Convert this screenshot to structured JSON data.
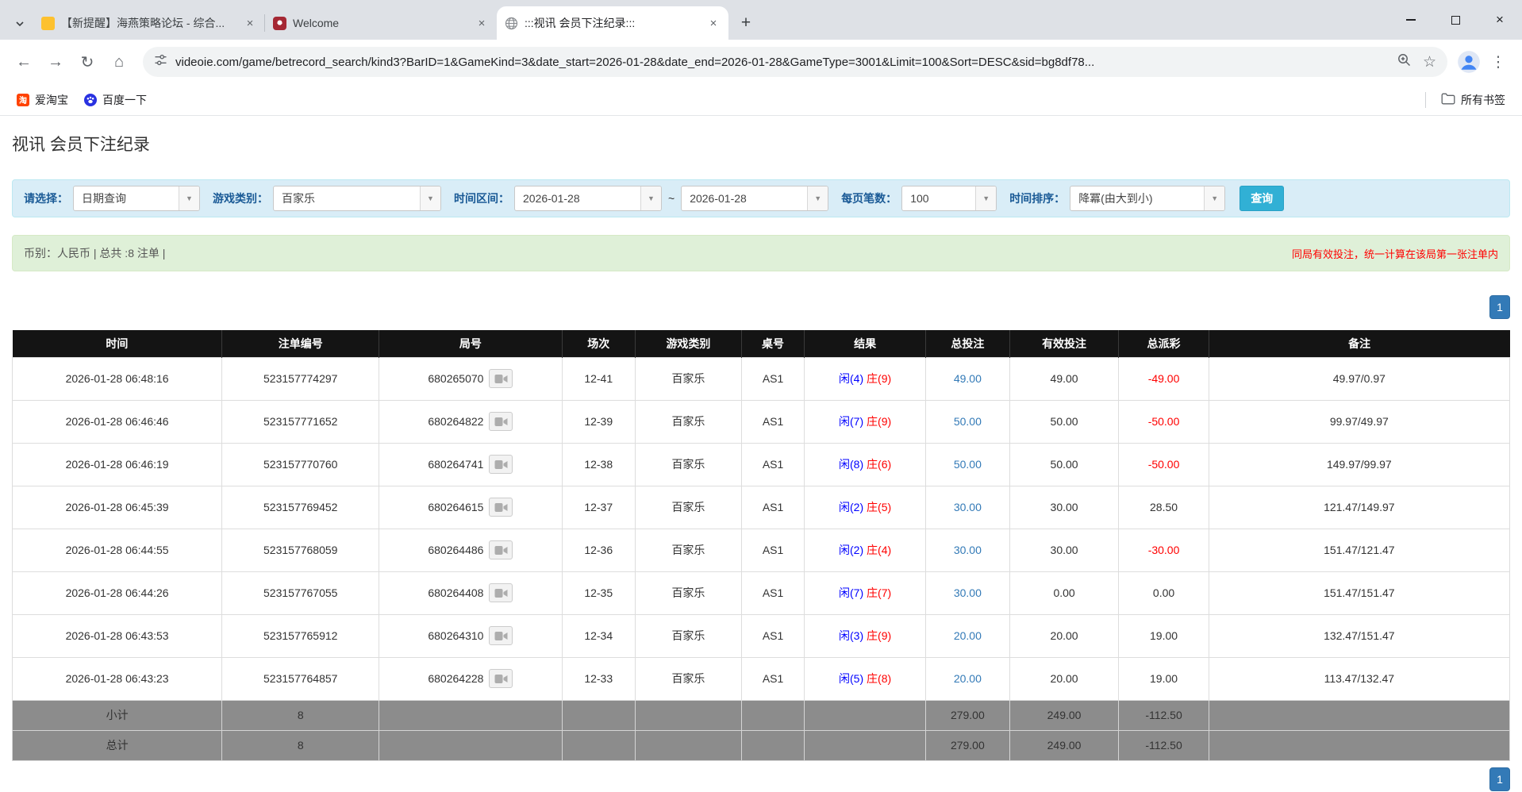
{
  "browser": {
    "tabs": [
      {
        "title": "【新提醒】海燕策略论坛 - 综合...",
        "active": false
      },
      {
        "title": "Welcome",
        "active": false
      },
      {
        "title": ":::视讯 会员下注纪录:::",
        "active": true
      }
    ],
    "url": "videoie.com/game/betrecord_search/kind3?BarID=1&GameKind=3&date_start=2026-01-28&date_end=2026-01-28&GameType=3001&Limit=100&Sort=DESC&sid=bg8df78...",
    "bookmarks": [
      {
        "label": "爱淘宝"
      },
      {
        "label": "百度一下"
      }
    ],
    "all_bookmarks_label": "所有书签"
  },
  "icons": {
    "dropdown": "▼",
    "back": "←",
    "forward": "→",
    "reload": "↻",
    "home": "⌂",
    "star": "☆",
    "menu": "⋮",
    "plus": "+",
    "close": "×",
    "taobao_glyph": "淘"
  },
  "page": {
    "title": "视讯 会员下注纪录",
    "filters": {
      "select_label": "请选择：",
      "select_value": "日期查询",
      "game_label": "游戏类别：",
      "game_value": "百家乐",
      "range_label": "时间区间：",
      "date_start": "2026-01-28",
      "range_separator": "~",
      "date_end": "2026-01-28",
      "per_page_label": "每页笔数：",
      "per_page_value": "100",
      "sort_label": "时间排序：",
      "sort_value": "降冪(由大到小)",
      "search_button": "查询"
    },
    "info_bar": {
      "left": "币别：人民币 | 总共 :8 注单 |",
      "right": "同局有效投注，统一计算在该局第一张注单内"
    },
    "pagination": {
      "page": "1"
    },
    "table": {
      "headers": [
        "时间",
        "注单编号",
        "局号",
        "场次",
        "游戏类别",
        "桌号",
        "结果",
        "总投注",
        "有效投注",
        "总派彩",
        "备注"
      ],
      "rows": [
        {
          "time": "2026-01-28 06:48:16",
          "bet_id": "523157774297",
          "round": "680265070",
          "session": "12-41",
          "game": "百家乐",
          "table_no": "AS1",
          "result_player": "闲(4)",
          "result_banker": "庄(9)",
          "total_bet": "49.00",
          "valid_bet": "49.00",
          "payout": "-49.00",
          "remark": "49.97/0.97"
        },
        {
          "time": "2026-01-28 06:46:46",
          "bet_id": "523157771652",
          "round": "680264822",
          "session": "12-39",
          "game": "百家乐",
          "table_no": "AS1",
          "result_player": "闲(7)",
          "result_banker": "庄(9)",
          "total_bet": "50.00",
          "valid_bet": "50.00",
          "payout": "-50.00",
          "remark": "99.97/49.97"
        },
        {
          "time": "2026-01-28 06:46:19",
          "bet_id": "523157770760",
          "round": "680264741",
          "session": "12-38",
          "game": "百家乐",
          "table_no": "AS1",
          "result_player": "闲(8)",
          "result_banker": "庄(6)",
          "total_bet": "50.00",
          "valid_bet": "50.00",
          "payout": "-50.00",
          "remark": "149.97/99.97"
        },
        {
          "time": "2026-01-28 06:45:39",
          "bet_id": "523157769452",
          "round": "680264615",
          "session": "12-37",
          "game": "百家乐",
          "table_no": "AS1",
          "result_player": "闲(2)",
          "result_banker": "庄(5)",
          "total_bet": "30.00",
          "valid_bet": "30.00",
          "payout": "28.50",
          "remark": "121.47/149.97"
        },
        {
          "time": "2026-01-28 06:44:55",
          "bet_id": "523157768059",
          "round": "680264486",
          "session": "12-36",
          "game": "百家乐",
          "table_no": "AS1",
          "result_player": "闲(2)",
          "result_banker": "庄(4)",
          "total_bet": "30.00",
          "valid_bet": "30.00",
          "payout": "-30.00",
          "remark": "151.47/121.47"
        },
        {
          "time": "2026-01-28 06:44:26",
          "bet_id": "523157767055",
          "round": "680264408",
          "session": "12-35",
          "game": "百家乐",
          "table_no": "AS1",
          "result_player": "闲(7)",
          "result_banker": "庄(7)",
          "total_bet": "30.00",
          "valid_bet": "0.00",
          "payout": "0.00",
          "remark": "151.47/151.47"
        },
        {
          "time": "2026-01-28 06:43:53",
          "bet_id": "523157765912",
          "round": "680264310",
          "session": "12-34",
          "game": "百家乐",
          "table_no": "AS1",
          "result_player": "闲(3)",
          "result_banker": "庄(9)",
          "total_bet": "20.00",
          "valid_bet": "20.00",
          "payout": "19.00",
          "remark": "132.47/151.47"
        },
        {
          "time": "2026-01-28 06:43:23",
          "bet_id": "523157764857",
          "round": "680264228",
          "session": "12-33",
          "game": "百家乐",
          "table_no": "AS1",
          "result_player": "闲(5)",
          "result_banker": "庄(8)",
          "total_bet": "20.00",
          "valid_bet": "20.00",
          "payout": "19.00",
          "remark": "113.47/132.47"
        }
      ],
      "footer": [
        {
          "label": "小计",
          "count": "8",
          "total_bet": "279.00",
          "valid_bet": "249.00",
          "payout": "-112.50"
        },
        {
          "label": "总计",
          "count": "8",
          "total_bet": "279.00",
          "valid_bet": "249.00",
          "payout": "-112.50"
        }
      ]
    }
  },
  "colors": {
    "accent_blue": "#337ab7",
    "result_player_blue": "#0000ff",
    "result_banker_red": "#ff0000",
    "negative_red": "#ff0000",
    "query_button": "#31b0d5",
    "filter_bg": "#d9edf7",
    "info_bg": "#dff0d8",
    "table_header_bg": "#141414",
    "summary_bg": "#8c8c8c"
  }
}
